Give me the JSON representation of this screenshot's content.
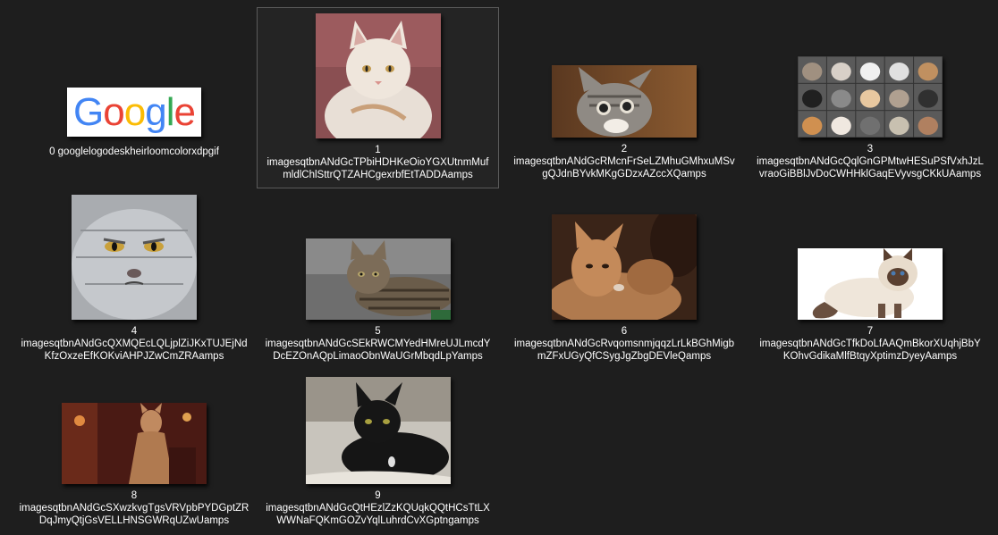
{
  "items": [
    {
      "index": "0",
      "name": "googlelogodeskheirloomcolorxdpgif",
      "caption_single": "0 googlelogodeskheirloomcolorxdpgif",
      "thumb": "google-logo-thumbnail"
    },
    {
      "index": "1",
      "line1": "imagesqtbnANdGcTPbiHDHKeOioYGXUtnmMuf",
      "line2": "mldlChlSttrQTZAHCgexrbfEtTADDAamps",
      "thumb": "white-cat-thumbnail"
    },
    {
      "index": "2",
      "line1": "imagesqtbnANdGcRMcnFrSeLZMhuGMhxuMSv",
      "line2": "gQJdnBYvkMKgGDzxAZccXQamps",
      "thumb": "tabby-kitten-thumbnail"
    },
    {
      "index": "3",
      "line1": "imagesqtbnANdGcQqlGnGPMtwHESuPSfVxhJzL",
      "line2": "vraoGiBBlJvDoCWHHklGaqEVyvsgCKkUAamps",
      "thumb": "cat-collage-thumbnail"
    },
    {
      "index": "4",
      "line1": "imagesqtbnANdGcQXMQEcLQLjplZiJKxTUJEjNd",
      "line2": "KfzOxzeEfKOKviAHPJZwCmZRAamps",
      "thumb": "grumpy-grey-cat-thumbnail"
    },
    {
      "index": "5",
      "line1": "imagesqtbnANdGcSEkRWCMYedHMreUJLmcdY",
      "line2": "DcEZOnAQpLimaoObnWaUGrMbqdLpYamps",
      "thumb": "lying-tabby-cat-thumbnail"
    },
    {
      "index": "6",
      "line1": "imagesqtbnANdGcRvqomsnmjqqzLrLkBGhMigb",
      "line2": "mZFxUGyQfCSygJgZbgDEVleQamps",
      "thumb": "cats-movie-still-thumbnail"
    },
    {
      "index": "7",
      "line1": "imagesqtbnANdGcTfkDoLfAAQmBkorXUqhjBbY",
      "line2": "KOhvGdikaMlfBtqyXptimzDyeyAamps",
      "thumb": "himalayan-cat-thumbnail"
    },
    {
      "index": "8",
      "line1": "imagesqtbnANdGcSXwzkvgTgsVRVpbPYDGptZR",
      "line2": "DqJmyQtjGsVELLHNSGWRqUZwUamps",
      "thumb": "cats-musical-thumbnail"
    },
    {
      "index": "9",
      "line1": "imagesqtbnANdGcQtHEzlZzKQUqkQQtHCsTtLX",
      "line2": "WWNaFQKmGOZvYqlLuhrdCvXGptngamps",
      "thumb": "black-cat-thumbnail"
    }
  ],
  "google_logo": {
    "letters": [
      "G",
      "o",
      "o",
      "g",
      "l",
      "e"
    ],
    "colors": [
      "#4285F4",
      "#EA4335",
      "#FBBC05",
      "#4285F4",
      "#34A853",
      "#EA4335"
    ]
  }
}
